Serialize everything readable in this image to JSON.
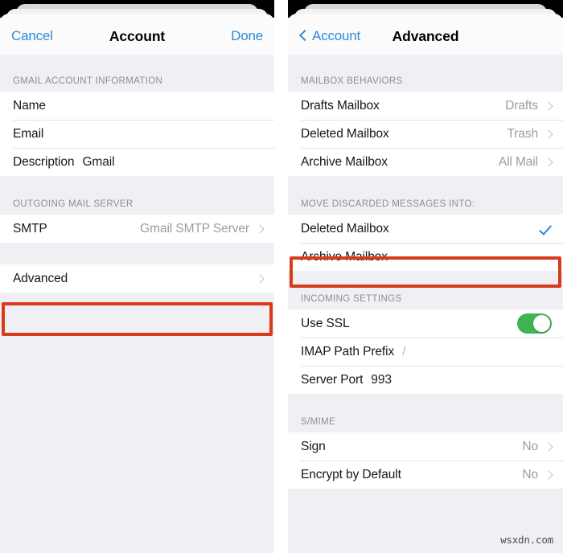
{
  "watermark": "wsxdn.com",
  "colors": {
    "accent_blue": "#2e8bd6",
    "highlight_red": "#d93a1c",
    "toggle_green": "#3cb552",
    "page_background": "#f0eff4",
    "row_background": "#ffffff"
  },
  "left_panel": {
    "navbar": {
      "cancel_label": "Cancel",
      "title": "Account",
      "done_label": "Done"
    },
    "sections": [
      {
        "header": "GMAIL ACCOUNT INFORMATION",
        "rows": [
          {
            "label": "Name",
            "inline_value": "",
            "value": "",
            "accessory": "none"
          },
          {
            "label": "Email",
            "inline_value": "",
            "value": "",
            "accessory": "none"
          },
          {
            "label": "Description",
            "inline_value": "Gmail",
            "value": "",
            "accessory": "none"
          }
        ]
      },
      {
        "header": "OUTGOING MAIL SERVER",
        "rows": [
          {
            "label": "SMTP",
            "inline_value": "",
            "value": "Gmail SMTP Server",
            "accessory": "chevron"
          }
        ]
      },
      {
        "header": "",
        "rows": [
          {
            "label": "Advanced",
            "inline_value": "",
            "value": "",
            "accessory": "chevron",
            "highlighted": true
          }
        ]
      }
    ]
  },
  "right_panel": {
    "navbar": {
      "back_label": "Account",
      "title": "Advanced"
    },
    "sections": [
      {
        "header": "MAILBOX BEHAVIORS",
        "rows": [
          {
            "label": "Drafts Mailbox",
            "inline_value": "",
            "value": "Drafts",
            "accessory": "chevron"
          },
          {
            "label": "Deleted Mailbox",
            "inline_value": "",
            "value": "Trash",
            "accessory": "chevron"
          },
          {
            "label": "Archive Mailbox",
            "inline_value": "",
            "value": "All Mail",
            "accessory": "chevron"
          }
        ]
      },
      {
        "header": "MOVE DISCARDED MESSAGES INTO:",
        "rows": [
          {
            "label": "Deleted Mailbox",
            "inline_value": "",
            "value": "",
            "accessory": "check",
            "highlighted": true
          },
          {
            "label": "Archive Mailbox",
            "inline_value": "",
            "value": "",
            "accessory": "none"
          }
        ]
      },
      {
        "header": "INCOMING SETTINGS",
        "rows": [
          {
            "label": "Use SSL",
            "inline_value": "",
            "value": "",
            "accessory": "toggle",
            "toggle_on": true
          },
          {
            "label": "IMAP Path Prefix",
            "inline_value": "/",
            "value": "",
            "accessory": "none"
          },
          {
            "label": "Server Port",
            "inline_value": "993",
            "value": "",
            "accessory": "none"
          }
        ]
      },
      {
        "header": "S/MIME",
        "rows": [
          {
            "label": "Sign",
            "inline_value": "",
            "value": "No",
            "accessory": "chevron"
          },
          {
            "label": "Encrypt by Default",
            "inline_value": "",
            "value": "No",
            "accessory": "chevron"
          }
        ]
      }
    ]
  }
}
